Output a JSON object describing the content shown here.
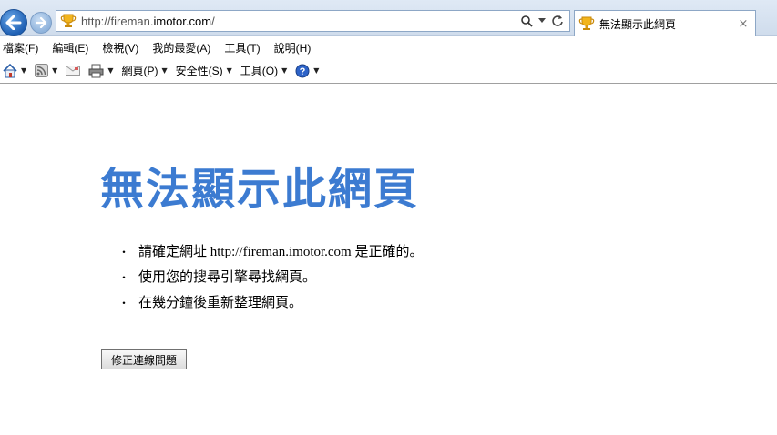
{
  "browser": {
    "address": {
      "url_prefix": "http://fireman.",
      "url_domain": "imotor.com",
      "url_suffix": "/"
    },
    "tab": {
      "title": "無法顯示此網頁",
      "close_glyph": "×"
    },
    "menu": [
      "檔案(F)",
      "編輯(E)",
      "檢視(V)",
      "我的最愛(A)",
      "工具(T)",
      "說明(H)"
    ],
    "commands": {
      "page": "網頁(P)",
      "safety": "安全性(S)",
      "tools": "工具(O)"
    },
    "accent_color": "#3c7bd1"
  },
  "page": {
    "title": "無法顯示此網頁",
    "bullet": "・",
    "items": [
      "請確定網址 http://fireman.imotor.com 是正確的。",
      "使用您的搜尋引擎尋找網頁。",
      "在幾分鐘後重新整理網頁。"
    ],
    "fix_button": "修正連線問題"
  }
}
